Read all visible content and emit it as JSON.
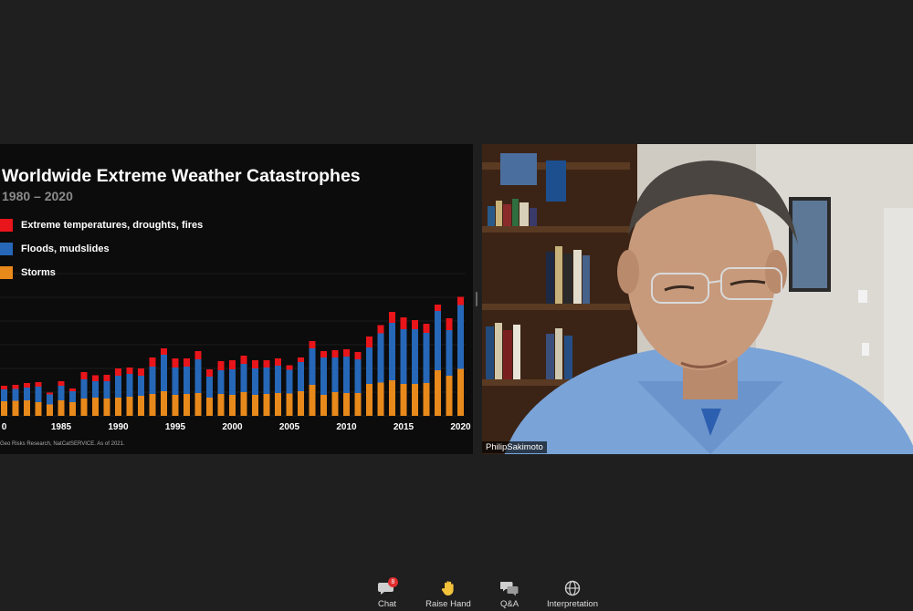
{
  "slide": {
    "title": "Worldwide Extreme Weather Catastrophes",
    "subtitle": "1980 – 2020",
    "source": "Geo Risks Research, NatCatSERVICE. As of 2021.",
    "legend": [
      {
        "label": "Extreme temperatures, droughts, fires",
        "color": "#e8151a"
      },
      {
        "label": "Floods, mudslides",
        "color": "#2667b8"
      },
      {
        "label": "Storms",
        "color": "#e8891b"
      }
    ]
  },
  "chart_data": {
    "type": "bar",
    "stacked": true,
    "x": [
      1980,
      1981,
      1982,
      1983,
      1984,
      1985,
      1986,
      1987,
      1988,
      1989,
      1990,
      1991,
      1992,
      1993,
      1994,
      1995,
      1996,
      1997,
      1998,
      1999,
      2000,
      2001,
      2002,
      2003,
      2004,
      2005,
      2006,
      2007,
      2008,
      2009,
      2010,
      2011,
      2012,
      2013,
      2014,
      2015,
      2016,
      2017,
      2018,
      2019,
      2020
    ],
    "xticks": [
      "0",
      "1985",
      "1990",
      "1995",
      "2000",
      "2005",
      "2010",
      "2015",
      "2020"
    ],
    "series": [
      {
        "name": "Storms",
        "color": "#e8891b",
        "values": [
          32,
          33,
          34,
          30,
          25,
          34,
          30,
          38,
          40,
          38,
          40,
          42,
          44,
          48,
          54,
          46,
          48,
          50,
          40,
          48,
          46,
          52,
          46,
          48,
          50,
          49,
          54,
          68,
          46,
          52,
          50,
          50,
          70,
          73,
          78,
          70,
          70,
          72,
          100,
          88,
          103
        ]
      },
      {
        "name": "Floods, mudslides",
        "color": "#2667b8",
        "values": [
          26,
          26,
          28,
          34,
          22,
          32,
          24,
          42,
          36,
          38,
          48,
          50,
          44,
          60,
          80,
          60,
          60,
          74,
          46,
          52,
          56,
          62,
          58,
          58,
          60,
          52,
          64,
          80,
          82,
          76,
          80,
          74,
          80,
          108,
          126,
          120,
          120,
          110,
          130,
          100,
          140
        ]
      },
      {
        "name": "Extreme temperatures, droughts, fires",
        "color": "#e8151a",
        "values": [
          8,
          9,
          10,
          10,
          4,
          10,
          6,
          16,
          13,
          14,
          16,
          14,
          16,
          20,
          14,
          20,
          18,
          18,
          16,
          20,
          20,
          18,
          18,
          16,
          16,
          10,
          10,
          16,
          14,
          16,
          16,
          16,
          24,
          18,
          24,
          26,
          20,
          20,
          14,
          26,
          18
        ]
      }
    ]
  },
  "participant": {
    "name": "PhilipSakimoto"
  },
  "toolbar": {
    "chat_label": "Chat",
    "chat_badge": "8",
    "raise_hand_label": "Raise Hand",
    "qa_label": "Q&A",
    "interpretation_label": "Interpretation"
  }
}
